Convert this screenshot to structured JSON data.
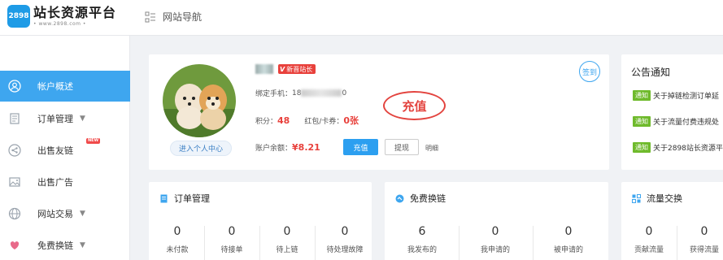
{
  "header": {
    "logo_badge": "2898",
    "logo_title": "站长资源平台",
    "logo_url": "• www.2898.com •",
    "nav_label": "网站导航"
  },
  "sidebar": {
    "items": [
      {
        "label": "帐户概述",
        "icon": "user-circle-icon"
      },
      {
        "label": "订单管理",
        "icon": "document-icon"
      },
      {
        "label": "出售友链",
        "icon": "share-icon",
        "badge": "NEW"
      },
      {
        "label": "出售广告",
        "icon": "image-icon"
      },
      {
        "label": "网站交易",
        "icon": "globe-icon"
      },
      {
        "label": "免费换链",
        "icon": "heart-hands-icon"
      }
    ]
  },
  "profile": {
    "vip_label": "新晋站长",
    "phone_label": "绑定手机：",
    "phone_prefix": "18",
    "phone_suffix": "0",
    "points_label": "积分：",
    "points_value": "48",
    "coupon_label": "红包/卡券：",
    "coupon_value": "0张",
    "balance_label": "账户余额：",
    "balance_value": "¥8.21",
    "recharge_btn": "充值",
    "withdraw_btn": "提现",
    "detail_link": "明细",
    "center_btn": "进入个人中心",
    "signin": "签到",
    "annotation": "充值"
  },
  "notice": {
    "title": "公告通知",
    "tag": "通知",
    "items": [
      "关于掉链检测订单延",
      "关于流量付费违规处",
      "关于2898站长资源平"
    ]
  },
  "orders": {
    "title": "订单管理",
    "stats": [
      {
        "value": "0",
        "label": "未付款"
      },
      {
        "value": "0",
        "label": "待接单"
      },
      {
        "value": "0",
        "label": "待上链"
      },
      {
        "value": "0",
        "label": "待处理故障"
      }
    ]
  },
  "exchange": {
    "title": "免费换链",
    "stats": [
      {
        "value": "6",
        "label": "我发布的"
      },
      {
        "value": "0",
        "label": "我申请的"
      },
      {
        "value": "0",
        "label": "被申请的"
      }
    ]
  },
  "traffic": {
    "title": "流量交换",
    "stats": [
      {
        "value": "0",
        "label": "贡献流量"
      },
      {
        "value": "0",
        "label": "获得流量"
      }
    ]
  },
  "colors": {
    "accent": "#3ea6ef",
    "danger": "#e8413c",
    "notice_tag": "#6fba2c"
  }
}
